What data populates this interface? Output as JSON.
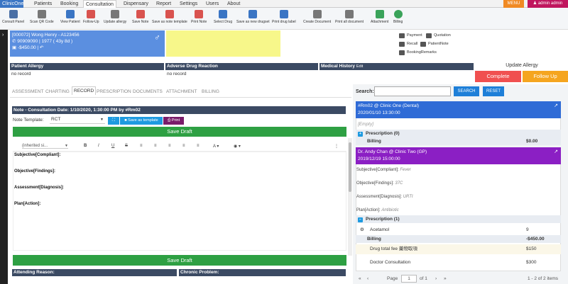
{
  "nav": {
    "brand": "ClinicOne",
    "items": [
      "Patients",
      "Booking",
      "Consultation",
      "Dispensary",
      "Report",
      "Settings",
      "Users",
      "About"
    ],
    "menu_label": "MENU",
    "user_label": "admin admin"
  },
  "toolbar": [
    {
      "label": "Consult Panel",
      "color": "#4a6fa5"
    },
    {
      "label": "Scan QR Code",
      "color": "#777"
    },
    {
      "label": "View Patient",
      "color": "#3a75c4"
    },
    {
      "label": "Follow-Up",
      "color": "#d9534f"
    },
    {
      "label": "Update allergy",
      "color": "#777"
    },
    {
      "label": "Save Note",
      "color": "#d9534f"
    },
    {
      "label": "Save as note template",
      "color": "#d9534f"
    },
    {
      "label": "Print Note",
      "color": "#d9534f"
    },
    {
      "label": "Select Drug",
      "color": "#3a75c4"
    },
    {
      "label": "Save as new drugset",
      "color": "#3a75c4"
    },
    {
      "label": "Print drug label",
      "color": "#3a75c4"
    },
    {
      "label": "Create Document",
      "color": "#777"
    },
    {
      "label": "Print all document",
      "color": "#777"
    },
    {
      "label": "Attachment",
      "color": "#3aa35a"
    },
    {
      "label": "Billing",
      "color": "#3aa35a"
    }
  ],
  "patient": {
    "id_name": "[000072] Wong Henry - A123456",
    "phone_year": "90909090 | 1977 ( 43y 8d )",
    "balance": "-$450.00 |",
    "gender_icon": "male-icon"
  },
  "side_buttons": [
    "Payment",
    "Quotation",
    "Recall",
    "PatientNote",
    "BookingRemarks"
  ],
  "headers": {
    "allergy": "Patient Allergy",
    "allergy_value": "no record",
    "adverse": "Adverse Drug Reaction",
    "adverse_value": "no record",
    "medical": "Medical History",
    "medical_edit": "Edit",
    "update_allergy": "Update Allergy",
    "complete": "Complete",
    "follow_up": "Follow Up"
  },
  "tabs": [
    "ASSESSMENT",
    "CHARTING",
    "RECORD",
    "PRESCRIPTION",
    "DOCUMENTS",
    "ATTACHMENT",
    "BILLING"
  ],
  "active_tab": "RECORD",
  "note": {
    "header": "Note - Consultation Date: 1/10/2020, 1:30:00 PM by #Rm02",
    "template_label": "Note Template:",
    "template_value": "RCT",
    "save_template": "Save as template",
    "print": "Print",
    "save_draft": "Save Draft",
    "font_select": "(inherited si...",
    "sections": [
      "Subjective[Compliant]:",
      "Objective[Findings]:",
      "Assessment[Diagnosis]:",
      "Plan[Action]:"
    ],
    "attending_reason": "Attending Reason:",
    "chronic_problem": "Chronic Problem:"
  },
  "search": {
    "label": "Search:",
    "placeholder": "",
    "search_btn": "SEARCH",
    "reset_btn": "RESET"
  },
  "visit1": {
    "title": "#Rm02 @ Clinic One (Dental)",
    "datetime": "2020/01/10 13:30:00",
    "empty": "[Empty]",
    "prescription": "Prescription (0)",
    "billing": "Billing",
    "billing_total": "$0.00",
    "color": "#2f6bd6"
  },
  "visit2": {
    "title": "Dr. Andy Chan @ Clinic Two (GP)",
    "datetime": "2019/12/19 15:00:00",
    "subjective_label": "Subjective[Compliant]:",
    "subjective_value": "Fever",
    "objective_label": "Objective[Findings]:",
    "objective_value": "37C",
    "assessment_label": "Assessment[Diagnosis]:",
    "assessment_value": "URTI",
    "plan_label": "Plan[Action]:",
    "plan_value": "Antibiotic",
    "prescription": "Prescription (1)",
    "drug_name": "Acetamol",
    "drug_qty": "9",
    "billing": "Billing",
    "billing_total": "-$450.00",
    "fee1_label": "Drug total fee 藥物取項",
    "fee1_value": "$150",
    "fee2_label": "Doctor Consultation",
    "fee2_value": "$300",
    "color": "#8b1fc4"
  },
  "pager": {
    "page_label": "Page",
    "page_value": "1",
    "of_label": "of 1",
    "summary": "1 - 2 of 2 items"
  }
}
